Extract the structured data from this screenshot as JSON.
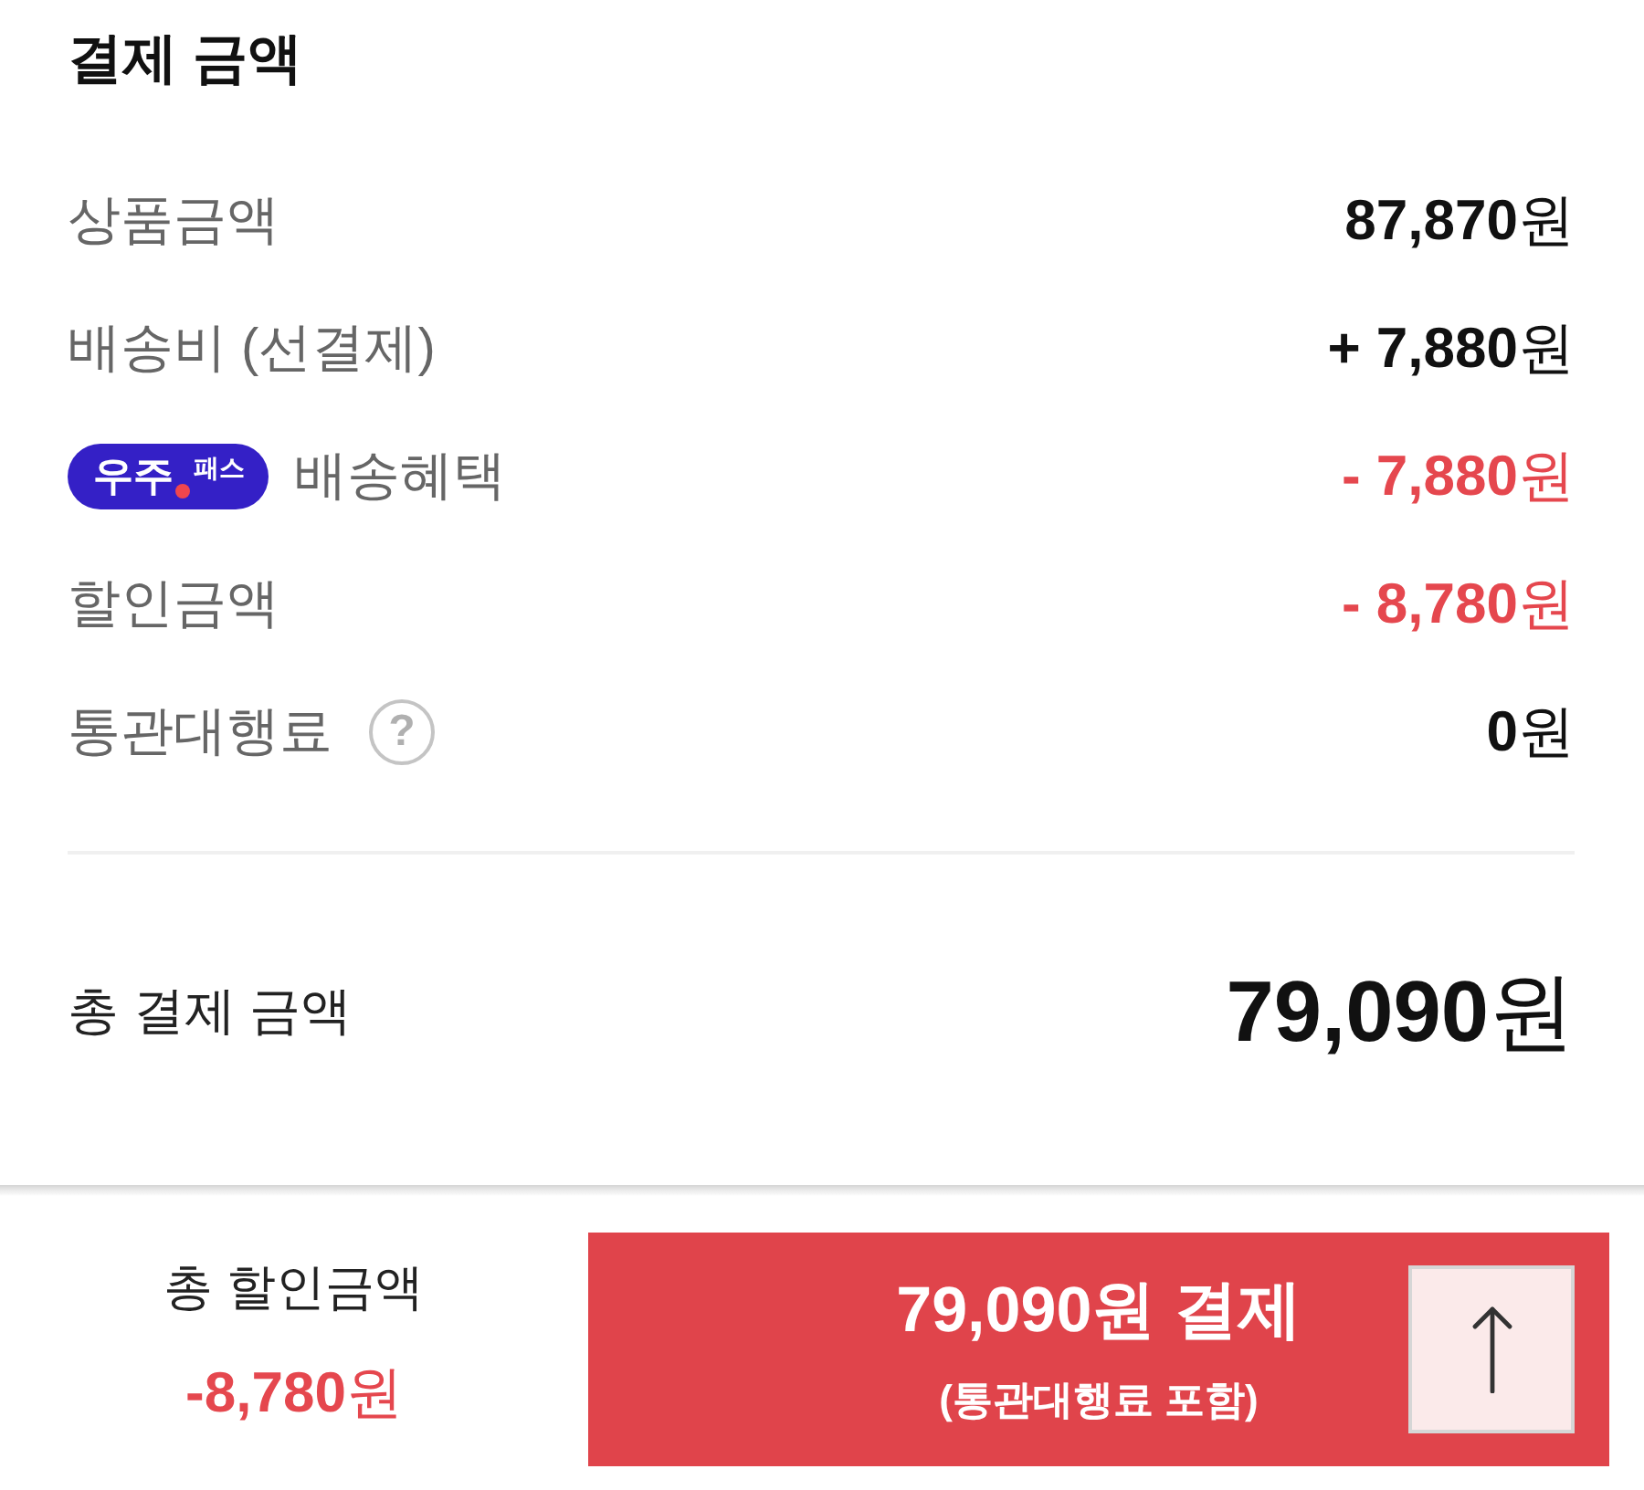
{
  "title": "결제 금액",
  "rows": [
    {
      "kind": "plain",
      "label": "상품금액",
      "value": "**87,870**원",
      "discount": false
    },
    {
      "kind": "plain",
      "label": "배송비 (선결제)",
      "value": "**+ 7,880**원",
      "discount": false
    },
    {
      "kind": "badge",
      "badge": {
        "name": "우주",
        "tag": "패스"
      },
      "label": "배송혜택",
      "value": "**- 7,880**원",
      "discount": true
    },
    {
      "kind": "plain",
      "label": "할인금액",
      "value": "**- 8,780**원",
      "discount": true
    },
    {
      "kind": "help",
      "label": "통관대행료",
      "help": "?",
      "value": "**0**원",
      "discount": false
    }
  ],
  "total": {
    "label": "총 결제 금액",
    "value": "**79,090**원"
  },
  "checkout_bar": {
    "discount_label": "총 할인금액",
    "discount_value": "**-8,780**원",
    "pay_button": {
      "title": "79,090원 결제",
      "note": "(통관대행료 포함)"
    }
  }
}
